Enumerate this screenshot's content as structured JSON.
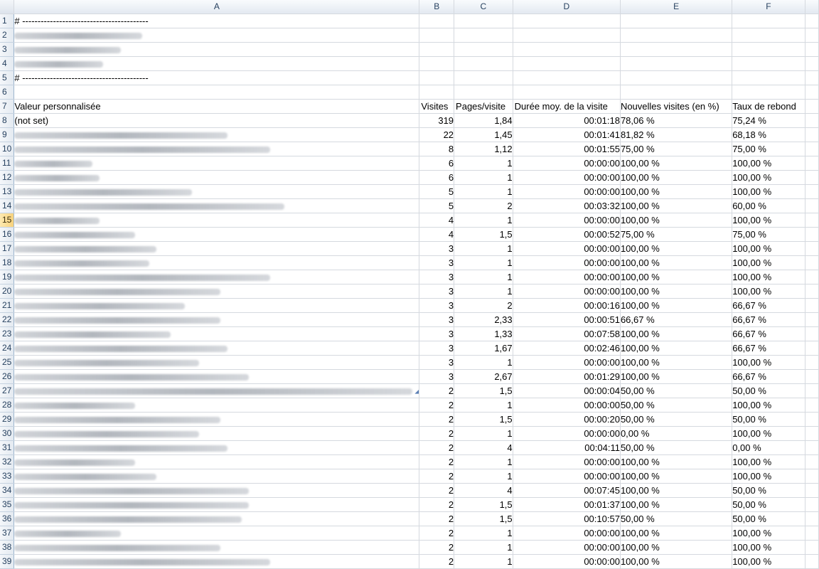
{
  "columns": [
    "A",
    "B",
    "C",
    "D",
    "E",
    "F"
  ],
  "header_rows": {
    "r1": "# -----------------------------------------",
    "r5": "# -----------------------------------------"
  },
  "table_header": {
    "a": "Valeur personnalisée",
    "b": "Visites",
    "c": "Pages/visite",
    "d": "Durée moy. de la visite",
    "e": "Nouvelles visites (en %)",
    "f": "Taux de rebond"
  },
  "first_value": "(not set)",
  "selected_row": 15,
  "data_rows": [
    [
      "319",
      "1,84",
      "00:01:18",
      "78,06 %",
      "75,24 %"
    ],
    [
      "22",
      "1,45",
      "00:01:41",
      "81,82 %",
      "68,18 %"
    ],
    [
      "8",
      "1,12",
      "00:01:55",
      "75,00 %",
      "75,00 %"
    ],
    [
      "6",
      "1",
      "00:00:00",
      "100,00 %",
      "100,00 %"
    ],
    [
      "6",
      "1",
      "00:00:00",
      "100,00 %",
      "100,00 %"
    ],
    [
      "5",
      "1",
      "00:00:00",
      "100,00 %",
      "100,00 %"
    ],
    [
      "5",
      "2",
      "00:03:32",
      "100,00 %",
      "60,00 %"
    ],
    [
      "4",
      "1",
      "00:00:00",
      "100,00 %",
      "100,00 %"
    ],
    [
      "4",
      "1,5",
      "00:00:52",
      "75,00 %",
      "75,00 %"
    ],
    [
      "3",
      "1",
      "00:00:00",
      "100,00 %",
      "100,00 %"
    ],
    [
      "3",
      "1",
      "00:00:00",
      "100,00 %",
      "100,00 %"
    ],
    [
      "3",
      "1",
      "00:00:00",
      "100,00 %",
      "100,00 %"
    ],
    [
      "3",
      "1",
      "00:00:00",
      "100,00 %",
      "100,00 %"
    ],
    [
      "3",
      "2",
      "00:00:16",
      "100,00 %",
      "66,67 %"
    ],
    [
      "3",
      "2,33",
      "00:00:51",
      "66,67 %",
      "66,67 %"
    ],
    [
      "3",
      "1,33",
      "00:07:58",
      "100,00 %",
      "66,67 %"
    ],
    [
      "3",
      "1,67",
      "00:02:46",
      "100,00 %",
      "66,67 %"
    ],
    [
      "3",
      "1",
      "00:00:00",
      "100,00 %",
      "100,00 %"
    ],
    [
      "3",
      "2,67",
      "00:01:29",
      "100,00 %",
      "66,67 %"
    ],
    [
      "2",
      "1,5",
      "00:00:04",
      "50,00 %",
      "50,00 %"
    ],
    [
      "2",
      "1",
      "00:00:00",
      "50,00 %",
      "100,00 %"
    ],
    [
      "2",
      "1,5",
      "00:00:20",
      "50,00 %",
      "50,00 %"
    ],
    [
      "2",
      "1",
      "00:00:00",
      "0,00 %",
      "100,00 %"
    ],
    [
      "2",
      "4",
      "00:04:11",
      "50,00 %",
      "0,00 %"
    ],
    [
      "2",
      "1",
      "00:00:00",
      "100,00 %",
      "100,00 %"
    ],
    [
      "2",
      "1",
      "00:00:00",
      "100,00 %",
      "100,00 %"
    ],
    [
      "2",
      "4",
      "00:07:45",
      "100,00 %",
      "50,00 %"
    ],
    [
      "2",
      "1,5",
      "00:01:37",
      "100,00 %",
      "50,00 %"
    ],
    [
      "2",
      "1,5",
      "00:10:57",
      "50,00 %",
      "50,00 %"
    ],
    [
      "2",
      "1",
      "00:00:00",
      "100,00 %",
      "100,00 %"
    ],
    [
      "2",
      "1",
      "00:00:00",
      "100,00 %",
      "100,00 %"
    ],
    [
      "2",
      "1",
      "00:00:00",
      "100,00 %",
      "100,00 %"
    ]
  ],
  "colors": {
    "grid_line": "#d5d9df",
    "header_text": "#27415f",
    "selected_row_header": "#f8d27c"
  }
}
